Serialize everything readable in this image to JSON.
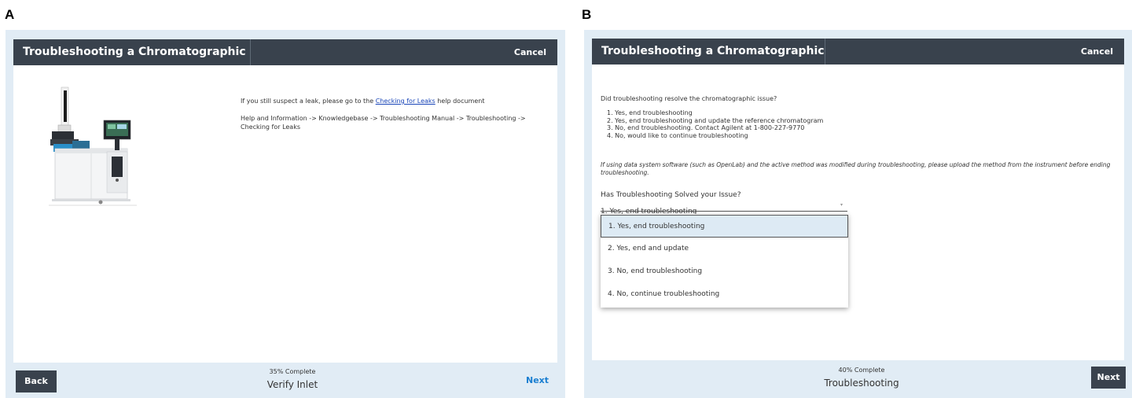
{
  "panel_a": {
    "label": "A",
    "title": "Troubleshooting a Chromatographic Issue",
    "cancel": "Cancel",
    "text_prefix": "If you still suspect a leak, please go to the ",
    "link": "Checking for Leaks",
    "text_suffix": " help document",
    "path": "Help and Information -> Knowledgebase -> Troubleshooting Manual -> Troubleshooting -> Checking for Leaks",
    "back": "Back",
    "progress_percent": "35% Complete",
    "step_name": "Verify Inlet",
    "next": "Next",
    "progress_value": 35
  },
  "panel_b": {
    "label": "B",
    "title": "Troubleshooting a Chromatographic Issue",
    "cancel": "Cancel",
    "question": "Did troubleshooting resolve the chromatographic issue?",
    "options": [
      "1. Yes, end troubleshooting",
      "2. Yes, end troubleshooting and update the reference chromatogram",
      "3. No, end troubleshooting. Contact Agilent at 1-800-227-9770",
      "4. No, would like to continue troubleshooting"
    ],
    "note": "If using data system software (such as OpenLab) and the active method was modified during troubleshooting, please upload the method from the instrument before ending troubleshooting.",
    "select_label": "Has Troubleshooting Solved your Issue?",
    "select_value": "1. Yes, end troubleshooting",
    "dropdown": [
      "1. Yes, end troubleshooting",
      "2. Yes, end and update",
      "3. No, end troubleshooting",
      "4. No, continue troubleshooting"
    ],
    "progress_percent": "40% Complete",
    "step_name": "Troubleshooting",
    "next": "Next",
    "progress_value": 40
  }
}
